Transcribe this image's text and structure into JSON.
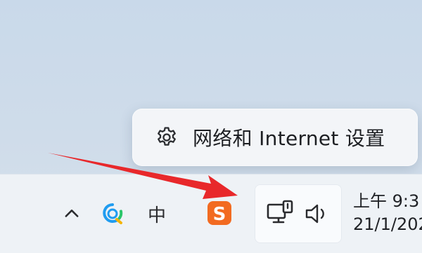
{
  "context_menu": {
    "items": [
      {
        "label": "网络和 Internet 设置",
        "icon": "gear-icon"
      }
    ]
  },
  "taskbar": {
    "tray": {
      "show_hidden_icon": "chevron-up-icon",
      "qq_icon": "qq-icon",
      "ime_label": "中",
      "sogou_icon": "sogou-icon"
    },
    "quick_settings": {
      "network_icon": "network-icon",
      "volume_icon": "volume-icon"
    },
    "clock": {
      "time": "上午 9:3",
      "date": "21/1/202"
    }
  },
  "annotation": {
    "arrow_color": "#e8282b"
  },
  "colors": {
    "desktop": "#cfdcea",
    "taskbar": "#eef2f6",
    "menu_bg": "#f3f5f8"
  }
}
